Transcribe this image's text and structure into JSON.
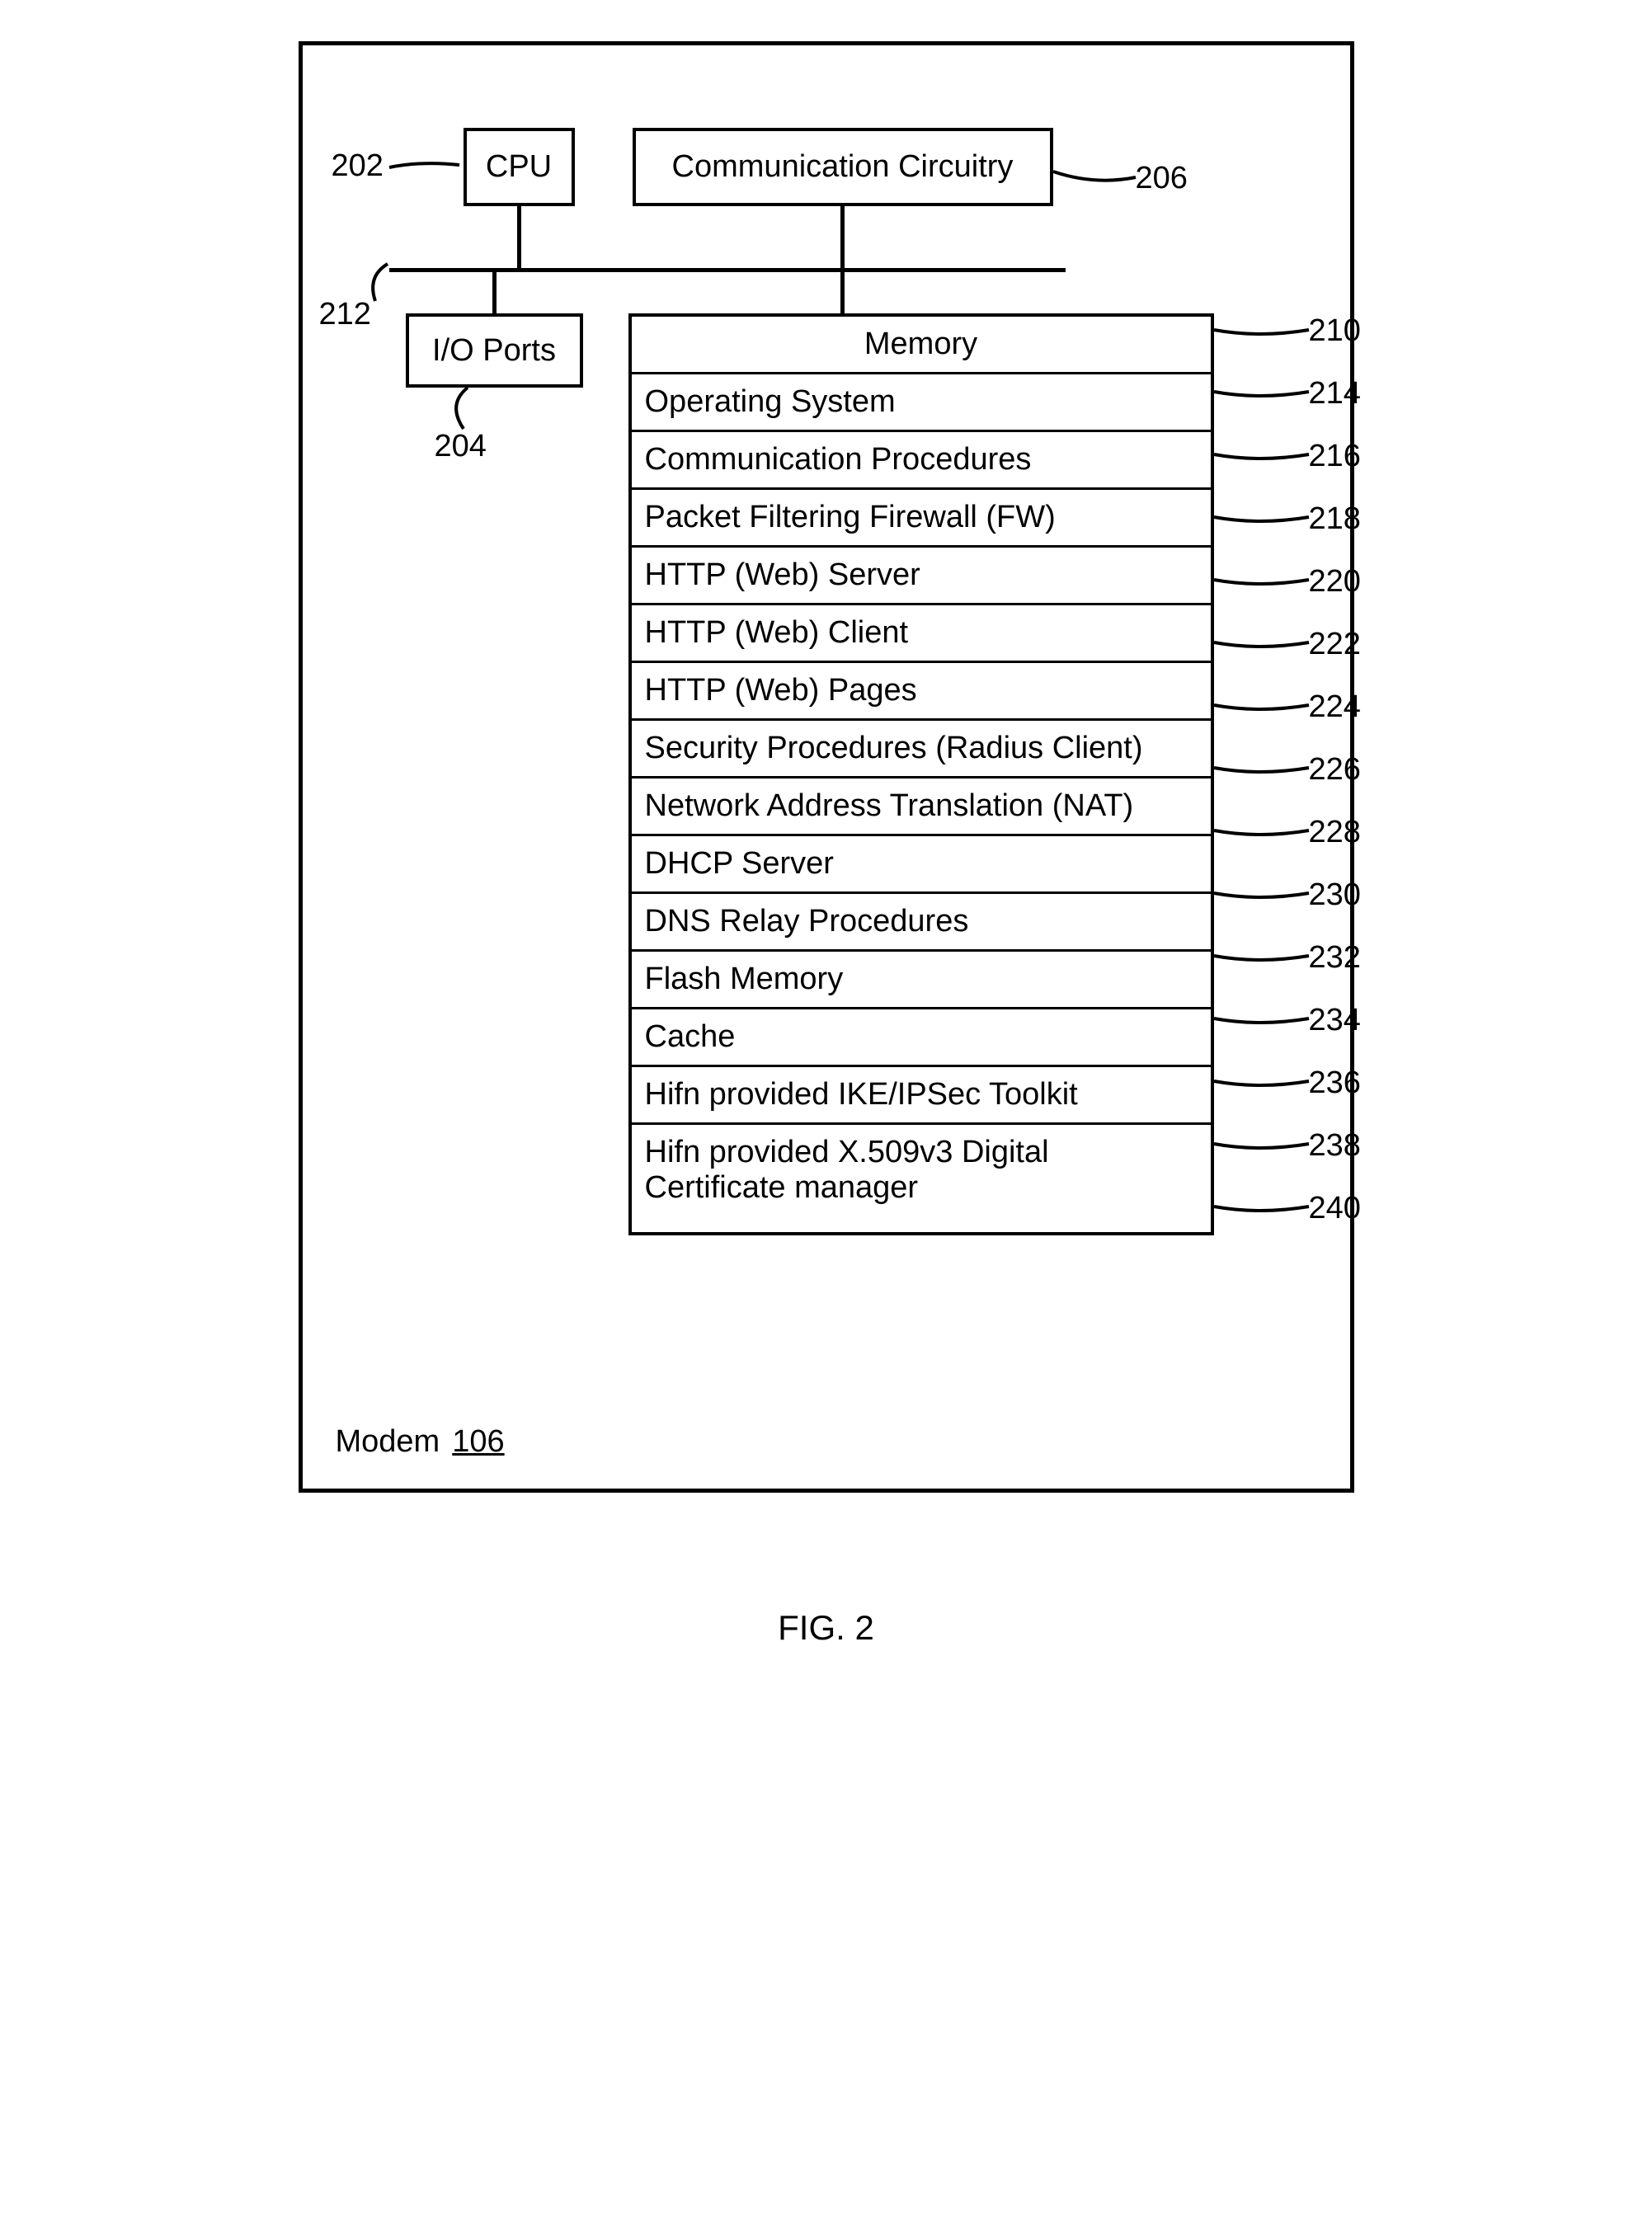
{
  "blocks": {
    "cpu": "CPU",
    "comm": "Communication Circuitry",
    "io": "I/O Ports",
    "memory_title": "Memory"
  },
  "memory_items": [
    "Operating System",
    "Communication Procedures",
    "Packet Filtering Firewall (FW)",
    "HTTP (Web) Server",
    "HTTP (Web) Client",
    "HTTP (Web) Pages",
    "Security Procedures (Radius Client)",
    "Network Address Translation (NAT)",
    "DHCP Server",
    "DNS Relay Procedures",
    "Flash Memory",
    "Cache",
    "Hifn provided IKE/IPSec Toolkit",
    "Hifn provided X.509v3 Digital Certificate manager"
  ],
  "refs": {
    "cpu": "202",
    "io": "204",
    "comm": "206",
    "memory": "210",
    "bus": "212",
    "mem_items": [
      "214",
      "216",
      "218",
      "220",
      "222",
      "224",
      "226",
      "228",
      "230",
      "232",
      "234",
      "236",
      "238",
      "240"
    ]
  },
  "modem_label": "Modem",
  "modem_num": "106",
  "figure": "FIG. 2"
}
